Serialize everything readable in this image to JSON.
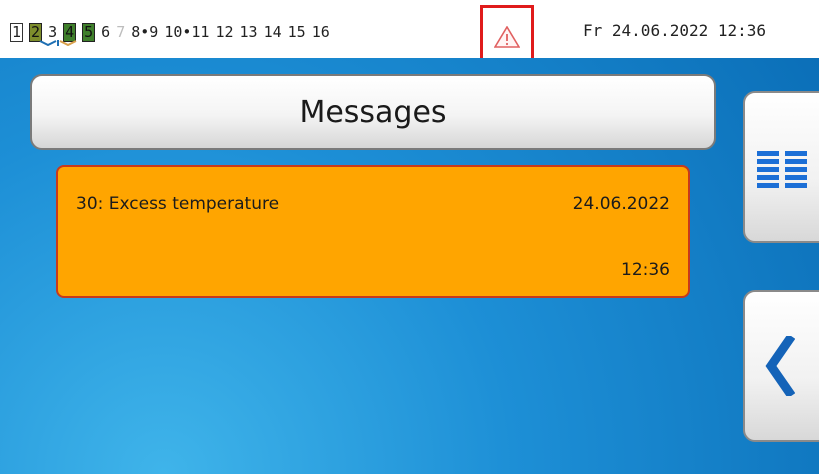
{
  "status_bar": {
    "outputs": [
      {
        "label": "1",
        "style": "boxed"
      },
      {
        "label": "2",
        "style": "olive"
      },
      {
        "label": "3",
        "style": "plain"
      },
      {
        "label": "4",
        "style": "green"
      },
      {
        "label": "5",
        "style": "green"
      },
      {
        "label": "6",
        "style": "plain"
      },
      {
        "label": "7",
        "style": "dim"
      },
      {
        "label": "8•9",
        "style": "plain"
      },
      {
        "label": "10•11",
        "style": "plain"
      },
      {
        "label": "12",
        "style": "plain"
      },
      {
        "label": "13",
        "style": "plain"
      },
      {
        "label": "14",
        "style": "plain"
      },
      {
        "label": "15",
        "style": "plain"
      },
      {
        "label": "16",
        "style": "plain"
      }
    ],
    "warning_icon": "warning-triangle-icon",
    "highlight_color": "#e01b1b",
    "day": "Fr",
    "date": "24.06.2022",
    "time": "12:36"
  },
  "screen": {
    "title": "Messages",
    "messages": [
      {
        "text": "30: Excess temperature",
        "date": "24.06.2022",
        "time": "12:36",
        "color": "#ffa500"
      }
    ],
    "menu_icon": "list-menu-icon",
    "back_icon": "chevron-left-icon"
  }
}
